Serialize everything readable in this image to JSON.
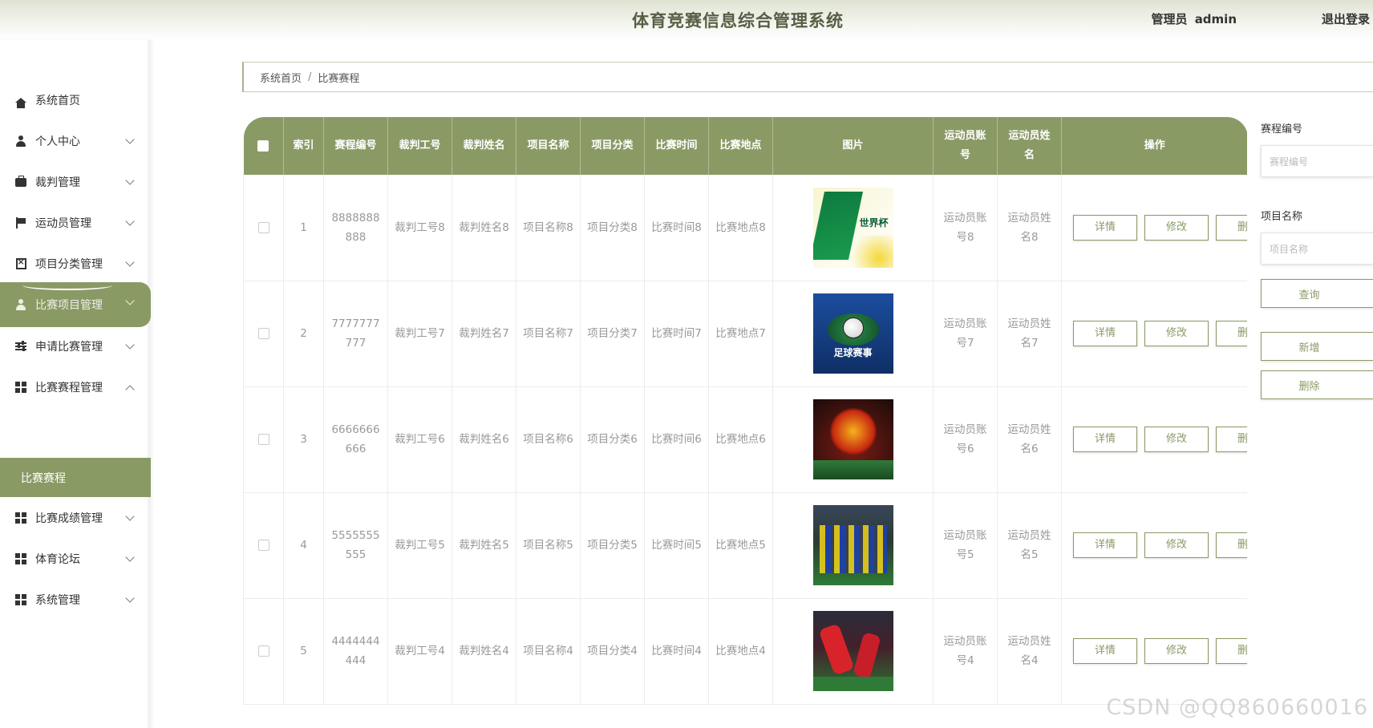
{
  "header": {
    "title": "体育竞赛信息综合管理系统",
    "role": "管理员",
    "username": "admin",
    "logout": "退出登录"
  },
  "sidebar": {
    "items": [
      {
        "label": "系统首页",
        "icon": "home-icon"
      },
      {
        "label": "个人中心",
        "icon": "user-icon"
      },
      {
        "label": "裁判管理",
        "icon": "briefcase-icon"
      },
      {
        "label": "运动员管理",
        "icon": "flag-icon"
      },
      {
        "label": "项目分类管理",
        "icon": "box-icon"
      },
      {
        "label": "比赛项目管理",
        "icon": "user-icon"
      },
      {
        "label": "申请比赛管理",
        "icon": "sliders-icon"
      },
      {
        "label": "比赛赛程管理",
        "icon": "grid-icon"
      },
      {
        "label": "比赛成绩管理",
        "icon": "grid-icon"
      },
      {
        "label": "体育论坛",
        "icon": "grid-icon"
      },
      {
        "label": "系统管理",
        "icon": "grid-icon"
      }
    ],
    "active_sub": "比赛赛程"
  },
  "breadcrumb": {
    "home": "系统首页",
    "separator": "/",
    "current": "比赛赛程"
  },
  "table": {
    "headers": [
      "索引",
      "赛程编号",
      "裁判工号",
      "裁判姓名",
      "项目名称",
      "项目分类",
      "比赛时间",
      "比赛地点",
      "图片",
      "运动员账号",
      "运动员姓名",
      "操作"
    ],
    "buttons": {
      "detail": "详情",
      "edit": "修改",
      "delete": "删除"
    },
    "rows": [
      {
        "index": "1",
        "code": "8888888888",
        "ref_id": "裁判工号8",
        "ref_name": "裁判姓名8",
        "proj_name": "项目名称8",
        "proj_cat": "项目分类8",
        "time": "比赛时间8",
        "place": "比赛地点8",
        "athlete_acc": "运动员账号8",
        "athlete_name": "运动员姓名8",
        "image_text": "世界杯"
      },
      {
        "index": "2",
        "code": "7777777777",
        "ref_id": "裁判工号7",
        "ref_name": "裁判姓名7",
        "proj_name": "项目名称7",
        "proj_cat": "项目分类7",
        "time": "比赛时间7",
        "place": "比赛地点7",
        "athlete_acc": "运动员账号7",
        "athlete_name": "运动员姓名7",
        "image_text": "足球赛事"
      },
      {
        "index": "3",
        "code": "6666666666",
        "ref_id": "裁判工号6",
        "ref_name": "裁判姓名6",
        "proj_name": "项目名称6",
        "proj_cat": "项目分类6",
        "time": "比赛时间6",
        "place": "比赛地点6",
        "athlete_acc": "运动员账号6",
        "athlete_name": "运动员姓名6",
        "image_text": ""
      },
      {
        "index": "4",
        "code": "5555555555",
        "ref_id": "裁判工号5",
        "ref_name": "裁判姓名5",
        "proj_name": "项目名称5",
        "proj_cat": "项目分类5",
        "time": "比赛时间5",
        "place": "比赛地点5",
        "athlete_acc": "运动员账号5",
        "athlete_name": "运动员姓名5",
        "image_text": ""
      },
      {
        "index": "5",
        "code": "4444444444",
        "ref_id": "裁判工号4",
        "ref_name": "裁判姓名4",
        "proj_name": "项目名称4",
        "proj_cat": "项目分类4",
        "time": "比赛时间4",
        "place": "比赛地点4",
        "athlete_acc": "运动员账号4",
        "athlete_name": "运动员姓名4",
        "image_text": ""
      }
    ]
  },
  "search": {
    "code_label": "赛程编号",
    "code_placeholder": "赛程编号",
    "name_label": "项目名称",
    "name_placeholder": "项目名称",
    "query": "查询",
    "add": "新增",
    "delete": "删除"
  },
  "watermark": "CSDN @QQ860660016",
  "colors": {
    "accent": "#8a9a65",
    "header_title": "#555f45"
  }
}
